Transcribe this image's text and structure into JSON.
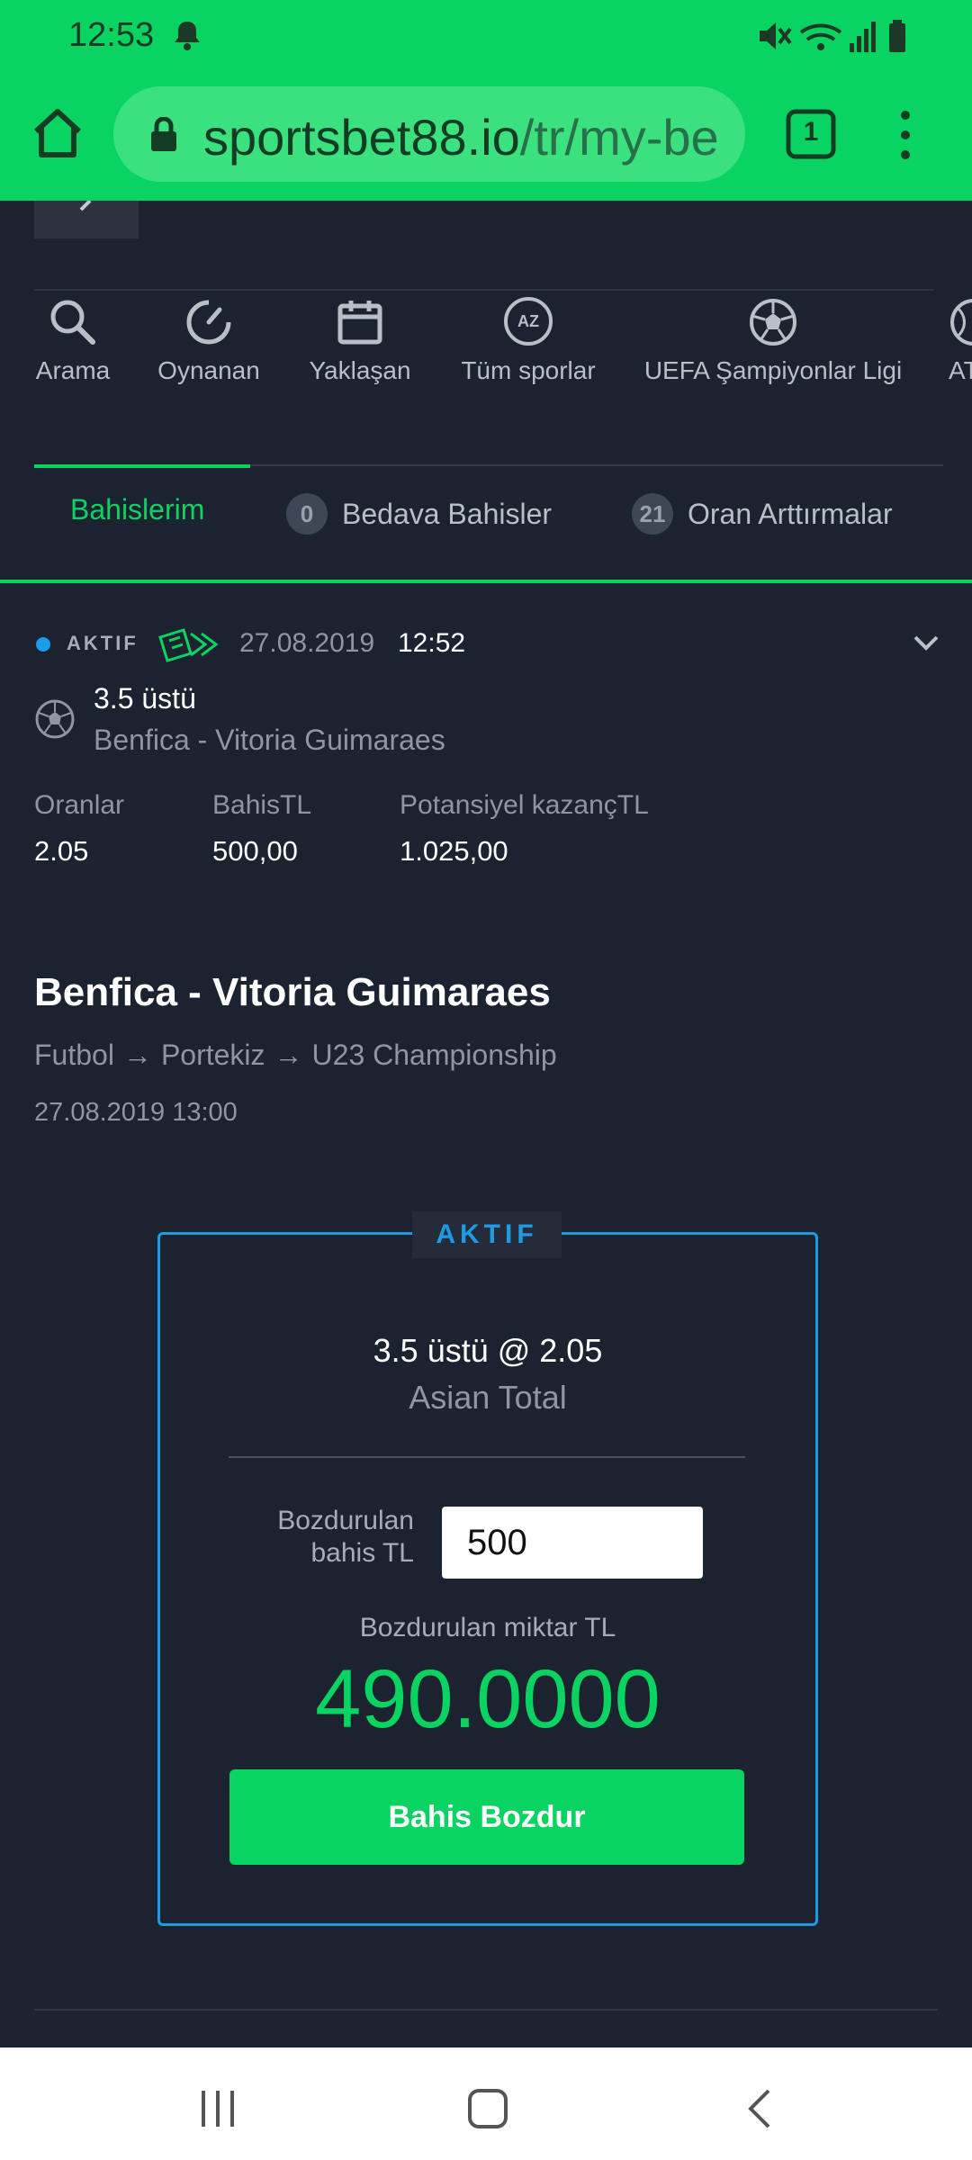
{
  "status_bar": {
    "time": "12:53"
  },
  "browser": {
    "url_host": "sportsbet88.io",
    "url_path": "/tr/my-be",
    "tab_count": "1"
  },
  "sport_nav": [
    {
      "label": "Arama",
      "icon": "search-icon"
    },
    {
      "label": "Oynanan",
      "icon": "live-gauge-icon"
    },
    {
      "label": "Yaklaşan",
      "icon": "calendar-icon"
    },
    {
      "label": "Tüm sporlar",
      "icon": "az-icon",
      "icon_text": "AZ"
    },
    {
      "label": "UEFA Şampiyonlar Ligi",
      "icon": "football-icon"
    },
    {
      "label": "AT",
      "icon": "ball-icon"
    }
  ],
  "tabs": [
    {
      "label": "Bahislerim",
      "active": true
    },
    {
      "label": "Bedava Bahisler",
      "badge": "0"
    },
    {
      "label": "Oran Arttırmalar",
      "badge": "21"
    }
  ],
  "bet": {
    "status": "AKTIF",
    "date": "27.08.2019",
    "time": "12:52",
    "selection": "3.5 üstü",
    "match": "Benfica - Vitoria Guimaraes",
    "stats": [
      {
        "label": "Oranlar",
        "value": "2.05"
      },
      {
        "label": "BahisTL",
        "value": "500,00"
      },
      {
        "label": "Potansiyel kazançTL",
        "value": "1.025,00"
      }
    ]
  },
  "event": {
    "title": "Benfica - Vitoria Guimaraes",
    "breadcrumb": [
      "Futbol",
      "Portekiz",
      "U23 Championship"
    ],
    "breadcrumb_arrow": "→",
    "datetime": "27.08.2019 13:00"
  },
  "cashout": {
    "status": "AKTIF",
    "selection_line": "3.5 üstü @ 2.05",
    "market": "Asian Total",
    "stake_label": "Bozdurulan bahis TL",
    "stake_value": "500",
    "amount_label": "Bozdurulan miktar TL",
    "amount": "490.0000",
    "button_label": "Bahis Bozdur"
  },
  "colors": {
    "accent": "#0ad461",
    "active_status": "#1e9be5",
    "background": "#1c2330"
  }
}
